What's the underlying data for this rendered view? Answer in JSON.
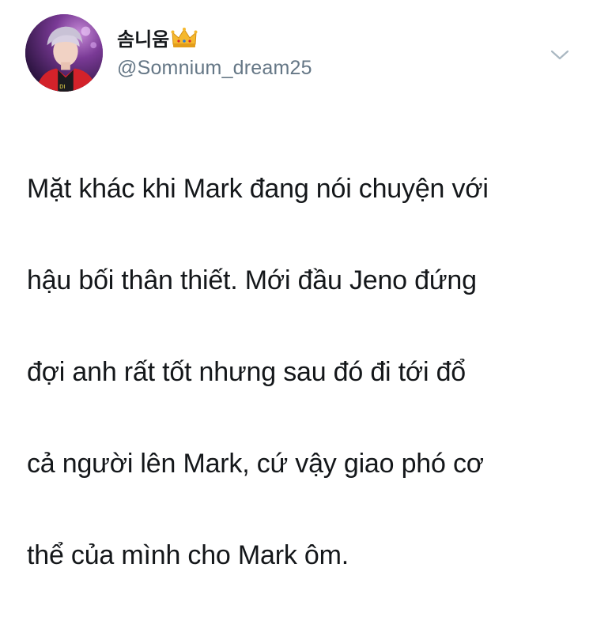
{
  "tweet": {
    "display_name": "솜니움",
    "name_emoji_icon": "crown-icon",
    "handle": "@Somnium_dream25",
    "more_icon": "chevron-down-icon",
    "text_lines": [
      "Mặt khác khi Mark đang nói chuyện với",
      "hậu bối thân thiết. Mới đầu Jeno đứng",
      "đợi anh rất tốt nhưng sau đó đi tới đổ",
      "cả người lên Mark, cứ vậy giao phó cơ",
      "thể của mình cho Mark ôm."
    ]
  },
  "colors": {
    "text": "#14171a",
    "secondary_text": "#657786",
    "crown": "#f5b82e"
  }
}
